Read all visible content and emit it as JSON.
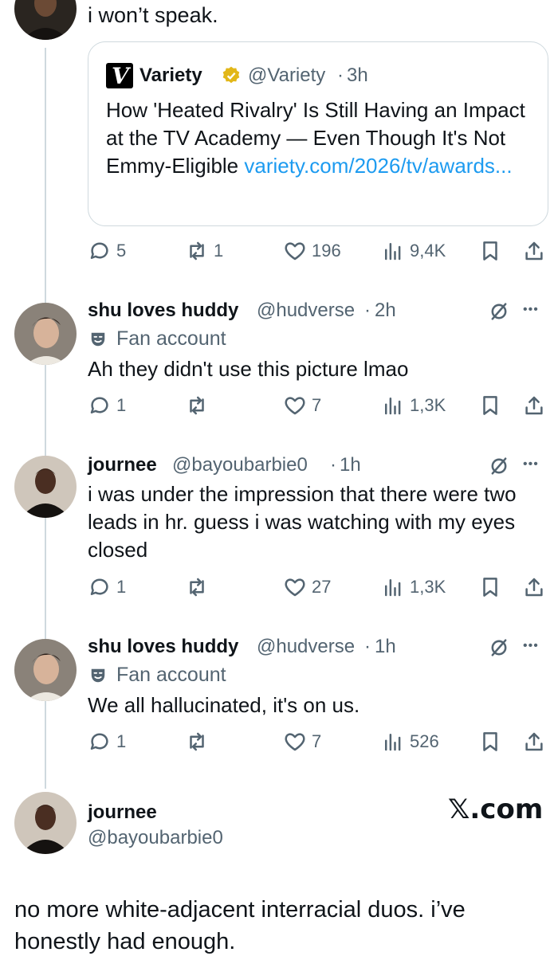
{
  "top_tweet": {
    "text": "i won’t speak."
  },
  "quote": {
    "source_name": "Variety",
    "source_handle": "@Variety",
    "time": "3h",
    "text": "How 'Heated Rivalry' Is Still Having an Impact at the TV Academy — Even Though It's Not Emmy-Eligible ",
    "link": "variety.com/2026/tv/awards...",
    "logo_letter": "V"
  },
  "top_actions": {
    "replies": "5",
    "reposts": "1",
    "likes": "196",
    "views": "9,4K"
  },
  "replies": [
    {
      "name": "shu loves huddy",
      "handle": "@hudverse",
      "time": "2h",
      "label": "Fan account",
      "text": "Ah they didn't use this picture lmao",
      "replies": "1",
      "reposts": "",
      "likes": "7",
      "views": "1,3K"
    },
    {
      "name": "journee",
      "handle": "@bayoubarbie0",
      "time": "1h",
      "label": "",
      "text": "i was under the impression that there were two leads in hr. guess i was watching with my eyes closed",
      "replies": "1",
      "reposts": "",
      "likes": "27",
      "views": "1,3K"
    },
    {
      "name": "shu loves huddy",
      "handle": "@hudverse",
      "time": "1h",
      "label": "Fan account",
      "text": "We all hallucinated, it's on us.",
      "replies": "1",
      "reposts": "",
      "likes": "7",
      "views": "526"
    }
  ],
  "final_tweet": {
    "name": "journee",
    "handle": "@bayoubarbie0",
    "brand": "𝕏.com",
    "text": "no more white-adjacent interracial duos. i’ve honestly had enough."
  },
  "icons": {
    "reply": "reply-icon",
    "repost": "repost-icon",
    "like": "heart-icon",
    "views": "views-icon",
    "bookmark": "bookmark-icon",
    "share": "share-icon",
    "grok": "grok-icon",
    "more": "more-icon",
    "fan": "fan-account-icon"
  },
  "colors": {
    "link": "#1d9bf0",
    "muted": "#536471",
    "verified_gold": "#e2b719",
    "line": "#cfd9de"
  }
}
